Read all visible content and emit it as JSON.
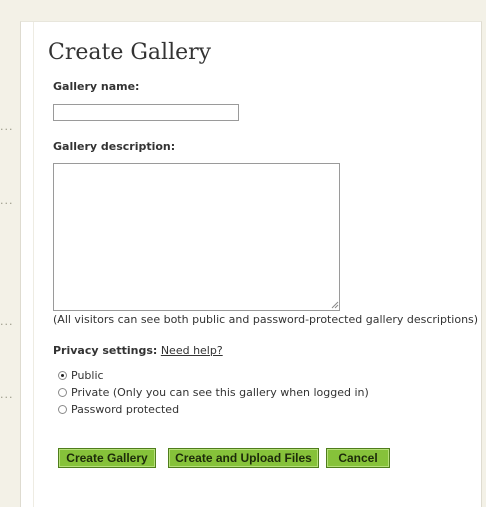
{
  "form": {
    "title": "Create Gallery",
    "name_label": "Gallery name:",
    "name_value": "",
    "description_label": "Gallery description:",
    "description_value": "",
    "description_note": "(All visitors can see both public and password-protected gallery descriptions)",
    "privacy_label": "Privacy settings:",
    "privacy_help": "Need help?",
    "privacy_options": [
      {
        "label": "Public",
        "selected": true
      },
      {
        "label": "Private (Only you can see this gallery when logged in)",
        "selected": false
      },
      {
        "label": "Password protected",
        "selected": false
      }
    ]
  },
  "buttons": {
    "create": "Create Gallery",
    "create_upload": "Create and Upload Files",
    "cancel": "Cancel"
  },
  "colors": {
    "page_bg": "#f3f1e7",
    "button_green": "#86c23a",
    "button_border": "#4f7d1c"
  }
}
